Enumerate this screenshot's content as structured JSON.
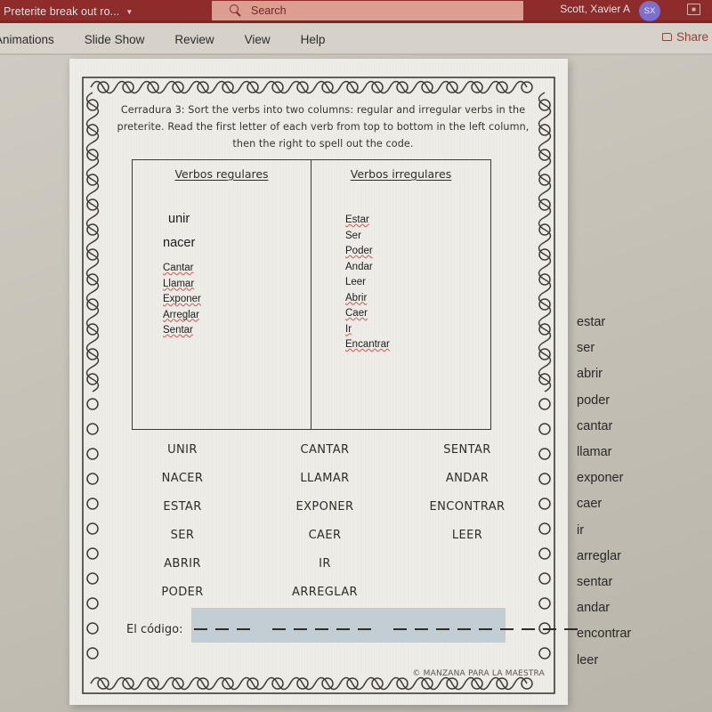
{
  "titlebar": {
    "doc_title": "Preterite break out ro...",
    "chevron": "▼",
    "search_placeholder": "Search",
    "search_icon": "search-icon",
    "user_name": "Scott, Xavier A",
    "avatar_initials": "SX",
    "tb_icon": "present-icon"
  },
  "ribbon": {
    "tabs": [
      {
        "label": "Animations"
      },
      {
        "label": "Slide Show"
      },
      {
        "label": "Review"
      },
      {
        "label": "View"
      },
      {
        "label": "Help"
      }
    ],
    "share_label": "Share"
  },
  "slide": {
    "instructions": "Cerradura 3: Sort the verbs into two columns: regular and irregular verbs in the preterite. Read the first letter of each verb from top to bottom in the left column, then the right to spell out the code.",
    "table": {
      "left": {
        "header": "Verbos regulares",
        "big_entries": [
          "unir",
          "nacer"
        ],
        "entries": [
          "Cantar",
          "Llamar",
          "Exponer",
          "Arreglar",
          "Sentar"
        ]
      },
      "right": {
        "header": "Verbos irregulares",
        "entries": [
          "Estar",
          "Ser",
          "Poder",
          "Andar",
          "Leer",
          "Abrir",
          "Caer",
          "Ir",
          "Encantrar"
        ]
      }
    },
    "wordbank": {
      "col1": [
        "UNIR",
        "NACER",
        "ESTAR",
        "SER",
        "ABRIR",
        "PODER"
      ],
      "col2": [
        "CANTAR",
        "LLAMAR",
        "EXPONER",
        "CAER",
        "IR",
        "ARREGLAR"
      ],
      "col3": [
        "SENTAR",
        "ANDAR",
        "ENCONTRAR",
        "LEER"
      ]
    },
    "code": {
      "label": "El código:",
      "blank_groups": [
        3,
        5,
        9
      ],
      "highlight_color": "#c3cdd4"
    },
    "copyright": "© MANZANA PARA LA MAESTRA"
  },
  "sidebar": {
    "items": [
      "estar",
      "ser",
      "abrir",
      "poder",
      "cantar",
      "llamar",
      "exponer",
      "caer",
      "ir",
      "arreglar",
      "sentar",
      "andar",
      "encontrar",
      "leer"
    ]
  },
  "colors": {
    "titlebar": "#8e2c2c",
    "search_field": "#dd9e92",
    "ribbon": "#d6d2ca",
    "avatar": "#7b6fd0",
    "paper": "#eeece6",
    "spellcheck_underline": "#d06c6c"
  }
}
